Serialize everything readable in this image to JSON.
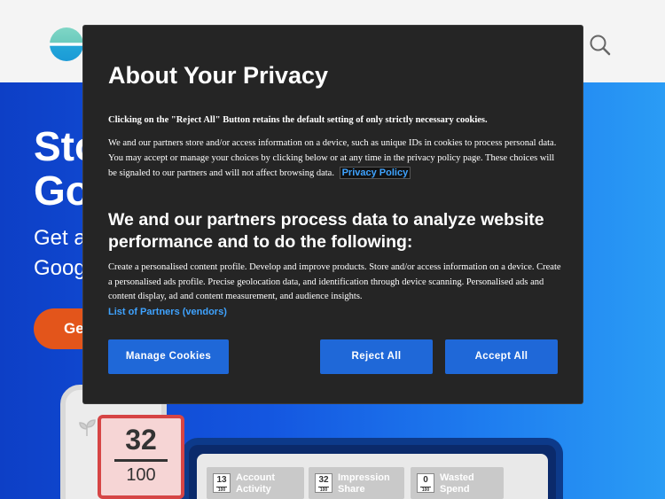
{
  "background": {
    "hero_title_line1": "Sto",
    "hero_title_line2": "Go",
    "hero_sub_line1": "Get a",
    "hero_sub_line2": "Goog",
    "cta_label": "Ge",
    "score": {
      "value": "32",
      "max": "100"
    },
    "metrics": [
      {
        "score": "13",
        "max": "100",
        "label_line1": "Account",
        "label_line2": "Activity"
      },
      {
        "score": "32",
        "max": "100",
        "label_line1": "Impression",
        "label_line2": "Share"
      },
      {
        "score": "0",
        "max": "100",
        "label_line1": "Wasted",
        "label_line2": "Spend"
      }
    ]
  },
  "modal": {
    "title": "About Your Privacy",
    "notice": "Clicking on the \"Reject All\" Button retains the default setting of only strictly necessary cookies.",
    "body": "We and our partners store and/or access information on a device, such as unique IDs in cookies to process personal data. You may accept or manage your choices by clicking below or at any time in the privacy policy page. These choices will be signaled to our partners and will not affect browsing data.",
    "privacy_link": "Privacy Policy",
    "subheading": "We and our partners process data to analyze website performance and to do the following:",
    "purposes": "Create a personalised content profile. Develop and improve products. Store and/or access information on a device. Create a personalised ads profile. Precise geolocation data, and identification through device scanning. Personalised ads and content display, ad and content measurement, and audience insights.",
    "partners_link": "List of Partners (vendors)",
    "buttons": {
      "manage": "Manage Cookies",
      "reject": "Reject All",
      "accept": "Accept All"
    }
  },
  "colors": {
    "accent_button": "#1f68d8",
    "link": "#3fa3ff",
    "modal_bg": "#252525"
  }
}
